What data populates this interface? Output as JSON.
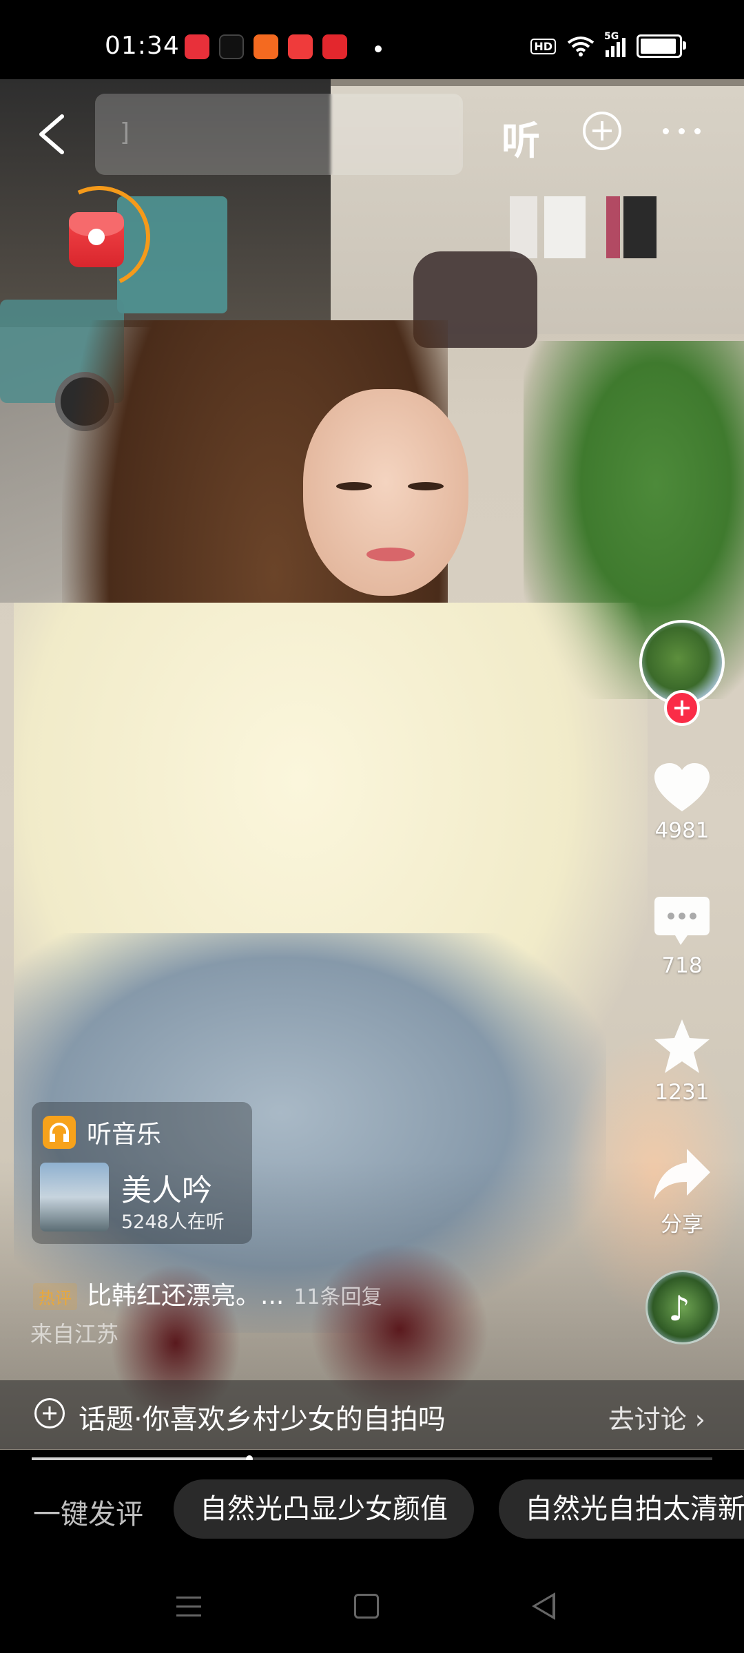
{
  "status_bar": {
    "time": "01:34",
    "hd_label": "HD",
    "signal_label": "5G",
    "app_icons": [
      "app-icon",
      "tiktok-icon",
      "app-icon",
      "video-app-icon",
      "toutiao-icon"
    ],
    "app_colors": [
      "#e8303a",
      "#111111",
      "#f46a20",
      "#ef3b3b",
      "#e3272d"
    ]
  },
  "top_bar": {
    "listen_label": "听",
    "search_placeholder": "]"
  },
  "right_rail": {
    "likes": "4981",
    "comments": "718",
    "favorites": "1231",
    "share_label": "分享"
  },
  "music_card": {
    "header": "听音乐",
    "song_title": "美人吟",
    "listeners": "5248人在听"
  },
  "comment": {
    "tag": "热评",
    "text": "比韩红还漂亮。...",
    "replies": "11条回复",
    "origin": "来自江苏"
  },
  "topic": {
    "text": "话题·你喜欢乡村少女的自拍吗",
    "action": "去讨论 ›"
  },
  "video": {
    "progress": 0.32
  },
  "quick_comment": {
    "label": "一键发评",
    "chips": [
      "自然光凸显少女颜值",
      "自然光自拍太清新"
    ]
  },
  "colors": {
    "accent_red": "#fa2c47",
    "accent_orange": "#f59a1a"
  }
}
